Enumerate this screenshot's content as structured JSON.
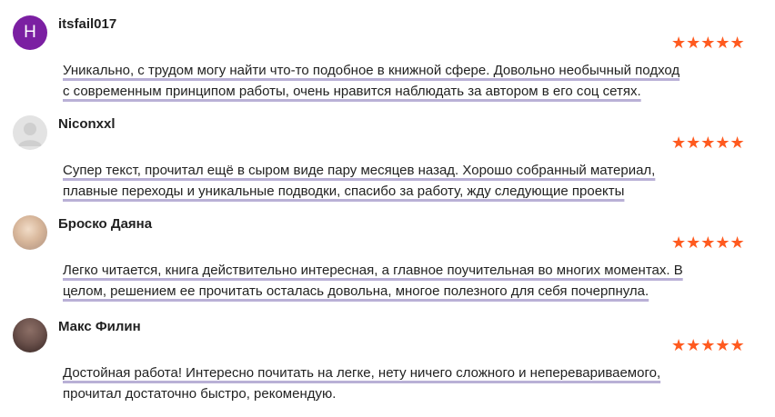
{
  "reviews": [
    {
      "author": "itsfail017",
      "avatar_letter": "H",
      "rating_stars": "★★★★★",
      "rating": 5,
      "text_line1": "Уникально, с трудом могу найти что-то подобное в книжной сфере. Довольно необычный подход",
      "text_line2": "с современным принципом работы, очень нравится наблюдать за автором в его соц сетях."
    },
    {
      "author": "Niconxxl",
      "rating_stars": "★★★★★",
      "rating": 5,
      "text_line1": "Супер текст, прочитал ещё в сыром виде пару месяцев назад. Хорошо собранный материал,",
      "text_line2": "плавные переходы и уникальные подводки, спасибо за работу, жду следующие проекты"
    },
    {
      "author": "Броско Даяна",
      "rating_stars": "★★★★★",
      "rating": 5,
      "text_line1": "Легко читается, книга действительно интересная, а главное поучительная во многих моментах. В",
      "text_line2": "целом, решением ее прочитать осталась довольна, многое полезного для себя почерпнула."
    },
    {
      "author": "Макс Филин",
      "rating_stars": "★★★★★",
      "rating": 5,
      "text_line1": "Достойная работа! Интересно почитать на легке, нету ничего сложного и неперевариваемого,",
      "text_line2": "прочитал достаточно быстро, рекомендую."
    }
  ],
  "colors": {
    "star": "#ff5a1f",
    "avatar_letter_bg": "#7b1fa2",
    "underline": "#b9b0d6"
  }
}
